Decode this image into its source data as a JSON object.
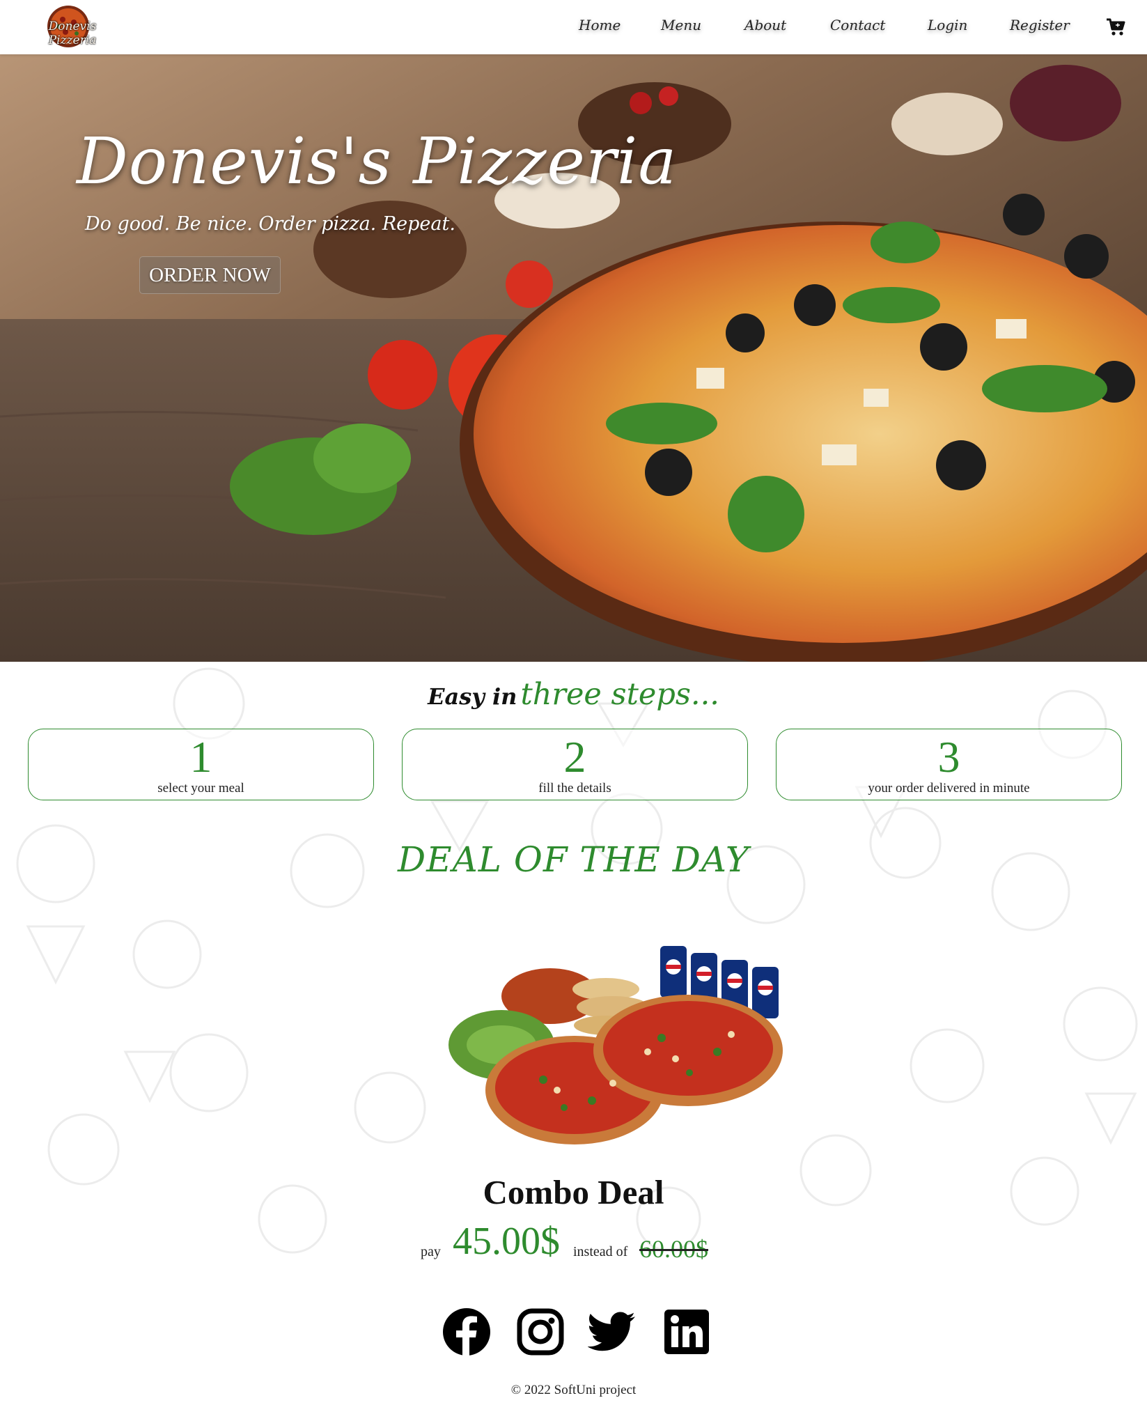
{
  "nav": {
    "logo_text": "Donevis Pizzeria",
    "links": [
      "Home",
      "Menu",
      "About",
      "Contact",
      "Login",
      "Register"
    ],
    "cart_icon": "shopping-cart-icon"
  },
  "hero": {
    "title": "Donevis's Pizzeria",
    "tagline": "Do good. Be nice. Order pizza. Repeat.",
    "cta": "ORDER NOW"
  },
  "steps": {
    "title_part1": "Easy in",
    "title_part2": "three steps...",
    "items": [
      {
        "number": "1",
        "text": "select your meal"
      },
      {
        "number": "2",
        "text": "fill the details"
      },
      {
        "number": "3",
        "text": "your order delivered in minute"
      }
    ]
  },
  "deal": {
    "heading": "DEAL OF THE DAY",
    "name": "Combo Deal",
    "pay_label": "pay",
    "price": "45.00$",
    "instead_label": "instead of",
    "old_price": "60.00$"
  },
  "social": [
    "facebook-icon",
    "instagram-icon",
    "twitter-icon",
    "linkedin-icon"
  ],
  "footer": {
    "copyright": "© 2022 SoftUni project"
  },
  "colors": {
    "accent": "#2e8b2e",
    "text": "#111111",
    "nav_bg": "#ffffff"
  }
}
